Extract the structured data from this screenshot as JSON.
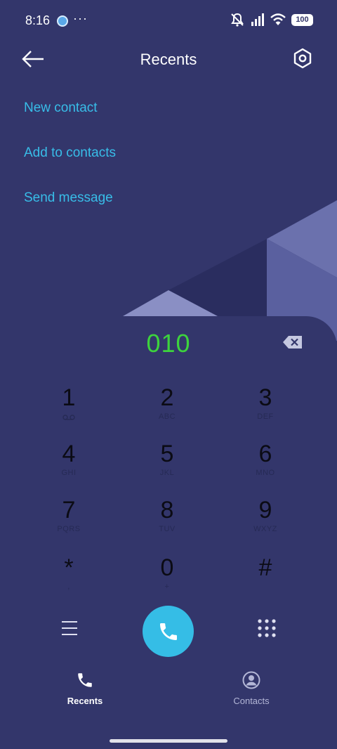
{
  "status_bar": {
    "time": "8:16",
    "more": "···",
    "battery": "100",
    "icons": [
      "app-notification-icon",
      "mute-icon",
      "signal-icon",
      "wifi-icon",
      "battery-icon"
    ]
  },
  "header": {
    "title": "Recents",
    "back_icon": "arrow-left-icon",
    "settings_icon": "settings-icon"
  },
  "actions": {
    "new_contact": "New contact",
    "add_to_contacts": "Add to contacts",
    "send_message": "Send message"
  },
  "dialer": {
    "number": "010",
    "keys": [
      {
        "digit": "1",
        "letters": ""
      },
      {
        "digit": "2",
        "letters": "ABC"
      },
      {
        "digit": "3",
        "letters": "DEF"
      },
      {
        "digit": "4",
        "letters": "GHI"
      },
      {
        "digit": "5",
        "letters": "JKL"
      },
      {
        "digit": "6",
        "letters": "MNO"
      },
      {
        "digit": "7",
        "letters": "PQRS"
      },
      {
        "digit": "8",
        "letters": "TUV"
      },
      {
        "digit": "9",
        "letters": "WXYZ"
      },
      {
        "digit": "*",
        "letters": ","
      },
      {
        "digit": "0",
        "letters": "+"
      },
      {
        "digit": "#",
        "letters": ""
      }
    ]
  },
  "bottom_nav": {
    "recents": "Recents",
    "contacts": "Contacts"
  },
  "colors": {
    "background": "#33366b",
    "accent": "#38bde8",
    "number": "#3dd33d",
    "call_button": "#35bde6"
  }
}
